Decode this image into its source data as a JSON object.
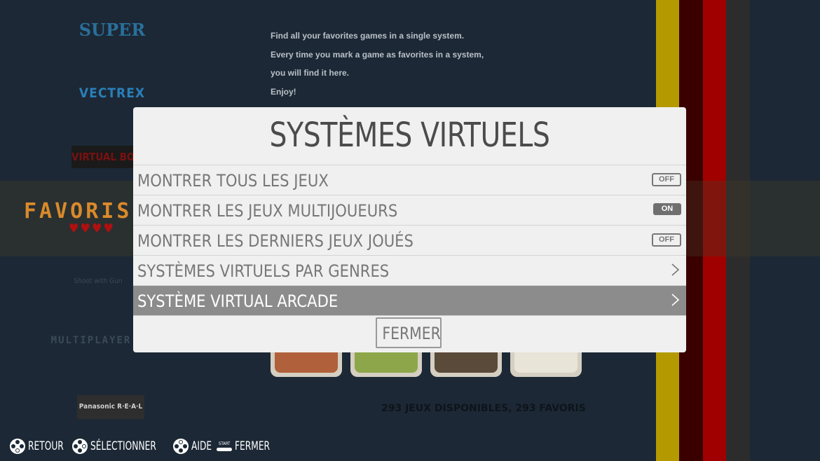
{
  "background": {
    "description_lines": [
      "Find all your favorites games in a single system.",
      "Every time you mark a game as favorites in a system,",
      "you will find it here.",
      "Enjoy!"
    ],
    "systems": [
      "SUPER",
      "VECTREX",
      "VIRTUAL BOY",
      "FAVORIS",
      "Shoot with Gun",
      "MULTIPLAYER",
      "Panasonic R·E·A·L"
    ],
    "status_text": "293 JEUX DISPONIBLES, 293 FAVORIS",
    "stripe_colors": [
      "#b49a00",
      "#3a0000",
      "#a00000",
      "#2c2c2c",
      "#1c2835"
    ]
  },
  "modal": {
    "title": "SYSTÈMES VIRTUELS",
    "rows": [
      {
        "label": "MONTRER TOUS LES JEUX",
        "control": "toggle",
        "value": "OFF"
      },
      {
        "label": "MONTRER LES JEUX MULTIJOUEURS",
        "control": "toggle",
        "value": "ON"
      },
      {
        "label": "MONTRER LES DERNIERS JEUX JOUÉS",
        "control": "toggle",
        "value": "OFF"
      },
      {
        "label": "SYSTÈMES VIRTUELS PAR GENRES",
        "control": "submenu"
      },
      {
        "label": "SYSTÈME VIRTUAL ARCADE",
        "control": "submenu",
        "selected": true
      }
    ],
    "close_label": "FERMER"
  },
  "footer": {
    "back": "RETOUR",
    "select": "SÉLECTIONNER",
    "help": "AIDE",
    "start_small": "START",
    "close": "FERMER"
  }
}
